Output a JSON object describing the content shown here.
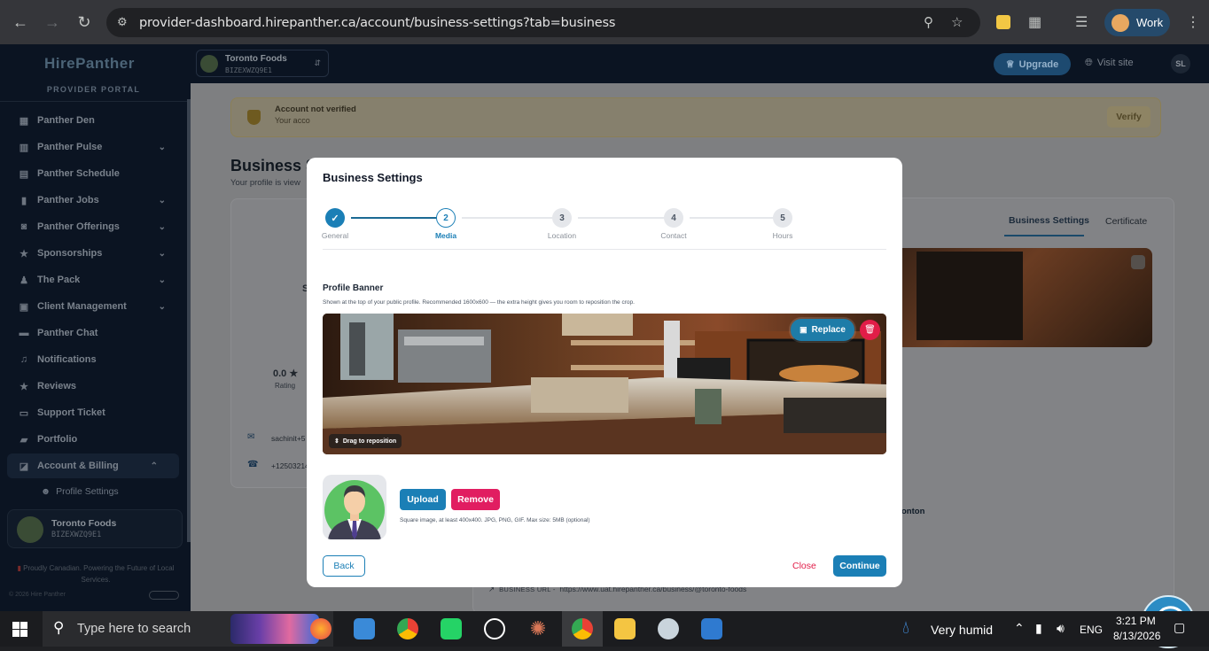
{
  "browser": {
    "url": "provider-dashboard.hirepanther.ca/account/business-settings?tab=business",
    "profile": "Work"
  },
  "sidebar": {
    "logo": "HirePanther",
    "portal": "PROVIDER PORTAL",
    "items": [
      {
        "label": "Panther Den",
        "icon": "grid-icon",
        "chevron": false
      },
      {
        "label": "Panther Pulse",
        "icon": "chart-icon",
        "chevron": true
      },
      {
        "label": "Panther Schedule",
        "icon": "calendar-icon",
        "chevron": false
      },
      {
        "label": "Panther Jobs",
        "icon": "bookmark-icon",
        "chevron": true
      },
      {
        "label": "Panther Offerings",
        "icon": "bag-icon",
        "chevron": true
      },
      {
        "label": "Sponsorships",
        "icon": "star-icon",
        "chevron": true
      },
      {
        "label": "The Pack",
        "icon": "users-icon",
        "chevron": true
      },
      {
        "label": "Client Management",
        "icon": "clipboard-icon",
        "chevron": true
      },
      {
        "label": "Panther Chat",
        "icon": "chat-icon",
        "chevron": false
      },
      {
        "label": "Notifications",
        "icon": "bell-icon",
        "chevron": false
      },
      {
        "label": "Reviews",
        "icon": "star-icon",
        "chevron": false
      },
      {
        "label": "Support Ticket",
        "icon": "ticket-icon",
        "chevron": false
      },
      {
        "label": "Portfolio",
        "icon": "briefcase-icon",
        "chevron": false
      },
      {
        "label": "Account & Billing",
        "icon": "account-icon",
        "chevron": true
      }
    ],
    "sub_item": "Profile Settings",
    "business_name": "Toronto Foods",
    "business_id": "BIZEXWZQ9E1",
    "footer": "Proudly Canadian. Powering the Future of Local Services.",
    "copyright": "© 2026 Hire Panther"
  },
  "topbar": {
    "business_name": "Toronto Foods",
    "business_id": "BIZEXWZQ9E1",
    "upgrade": "Upgrade",
    "visit_site": "Visit site",
    "user_initials": "SL"
  },
  "background": {
    "verify_title": "Account not verified",
    "verify_text": "Your acco",
    "verify_button": "Verify",
    "page_title": "Business S",
    "page_subtitle": "Your profile is view",
    "tab_business": "Business Settings",
    "tab_certificate": "Certificate",
    "rating": "0.0 ★",
    "rating_label": "Rating",
    "email": "sachinit+5",
    "phone": "+12503214",
    "city": "onton",
    "dash1": "—",
    "dash2": "—",
    "url_label": "BUSINESS URL -",
    "url_value": "https://www.uat.hirepanther.ca/business/@toronto-foods",
    "partial_letter": "S"
  },
  "modal": {
    "title": "Business Settings",
    "steps": [
      {
        "num": "✓",
        "label": "General",
        "state": "done"
      },
      {
        "num": "2",
        "label": "Media",
        "state": "current"
      },
      {
        "num": "3",
        "label": "Location",
        "state": "todo"
      },
      {
        "num": "4",
        "label": "Contact",
        "state": "todo"
      },
      {
        "num": "5",
        "label": "Hours",
        "state": "todo"
      }
    ],
    "banner_title": "Profile Banner",
    "banner_desc": "Shown at the top of your public profile. Recommended 1600x600 — the extra height gives you room to reposition the crop.",
    "replace": "Replace",
    "drag_hint": "Drag to reposition",
    "upload": "Upload",
    "remove": "Remove",
    "upload_hint": "Square image, at least 400x400. JPG, PNG, GIF. Max size: 5MB (optional)",
    "back": "Back",
    "close": "Close",
    "continue": "Continue"
  },
  "taskbar": {
    "search_placeholder": "Type here to search",
    "weather": "Very humid",
    "lang": "ENG",
    "time": "3:21 PM",
    "date": "8/13/2026"
  }
}
